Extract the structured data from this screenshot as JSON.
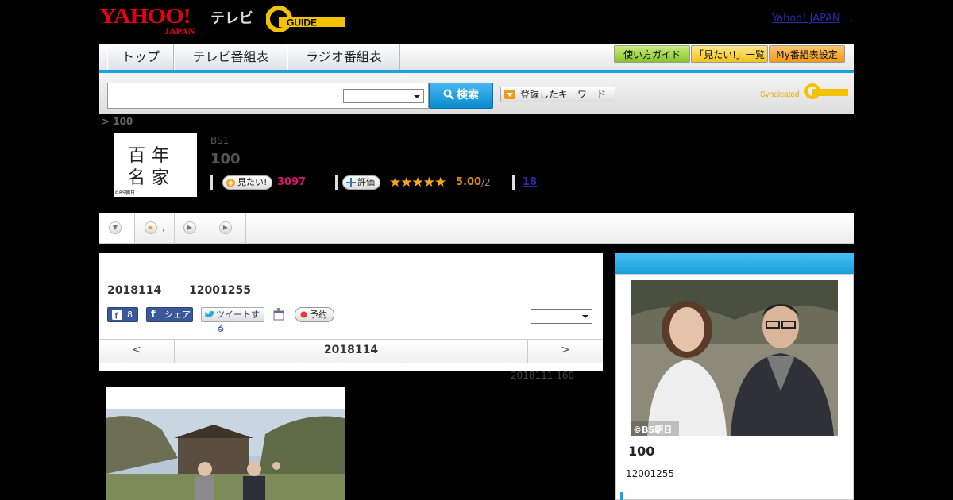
{
  "header": {
    "logo_yahoo": "YAHOO!",
    "logo_japan": "JAPAN",
    "logo_tv": "テレビ",
    "gguide_text": "GUIDE",
    "yahoo_japan_link": "Yahoo! JAPAN",
    "link_separator": ","
  },
  "nav": {
    "tabs": [
      {
        "label": "トップ"
      },
      {
        "label": "テレビ番組表"
      },
      {
        "label": "ラジオ番組表"
      }
    ],
    "guide_label": "使い方ガイド",
    "mitai_list_label": "「見たい!」一覧",
    "my_setting_label": "My番組表設定"
  },
  "search": {
    "button_label": "検索",
    "keyword_label": "登録したキーワード",
    "syndicated_label": "Syndicated"
  },
  "breadcrumb": "> 100",
  "program": {
    "channel": "BS1",
    "title": "100",
    "thumb_text": [
      "百",
      "年",
      "名",
      "家"
    ],
    "thumb_credit": "©BS朝日",
    "mitai_label": "見たい!",
    "mitai_count": "3097",
    "rate_label": "評価",
    "stars": "★★★★★",
    "rating": "5.00",
    "rating_count": "/2",
    "link_count": "18"
  },
  "tabs": {
    "tab2_text": ","
  },
  "main": {
    "date": "2018114",
    "time": "12001255",
    "fb_like_count": "8",
    "fb_share_label": "シェア",
    "tweet_label": "ツイートする",
    "reserve_label": "予約",
    "prev_label": "<",
    "current_date": "2018114",
    "next_label": ">",
    "updated": "2018111  160"
  },
  "sidebar": {
    "photo_credit": "©BS朝日",
    "title": "100",
    "time": "12001255"
  },
  "colors": {
    "accent_blue": "#1aa1e1",
    "yahoo_red": "#e60012",
    "mitai_pink": "#d6146e",
    "star_orange": "#f5a623"
  }
}
